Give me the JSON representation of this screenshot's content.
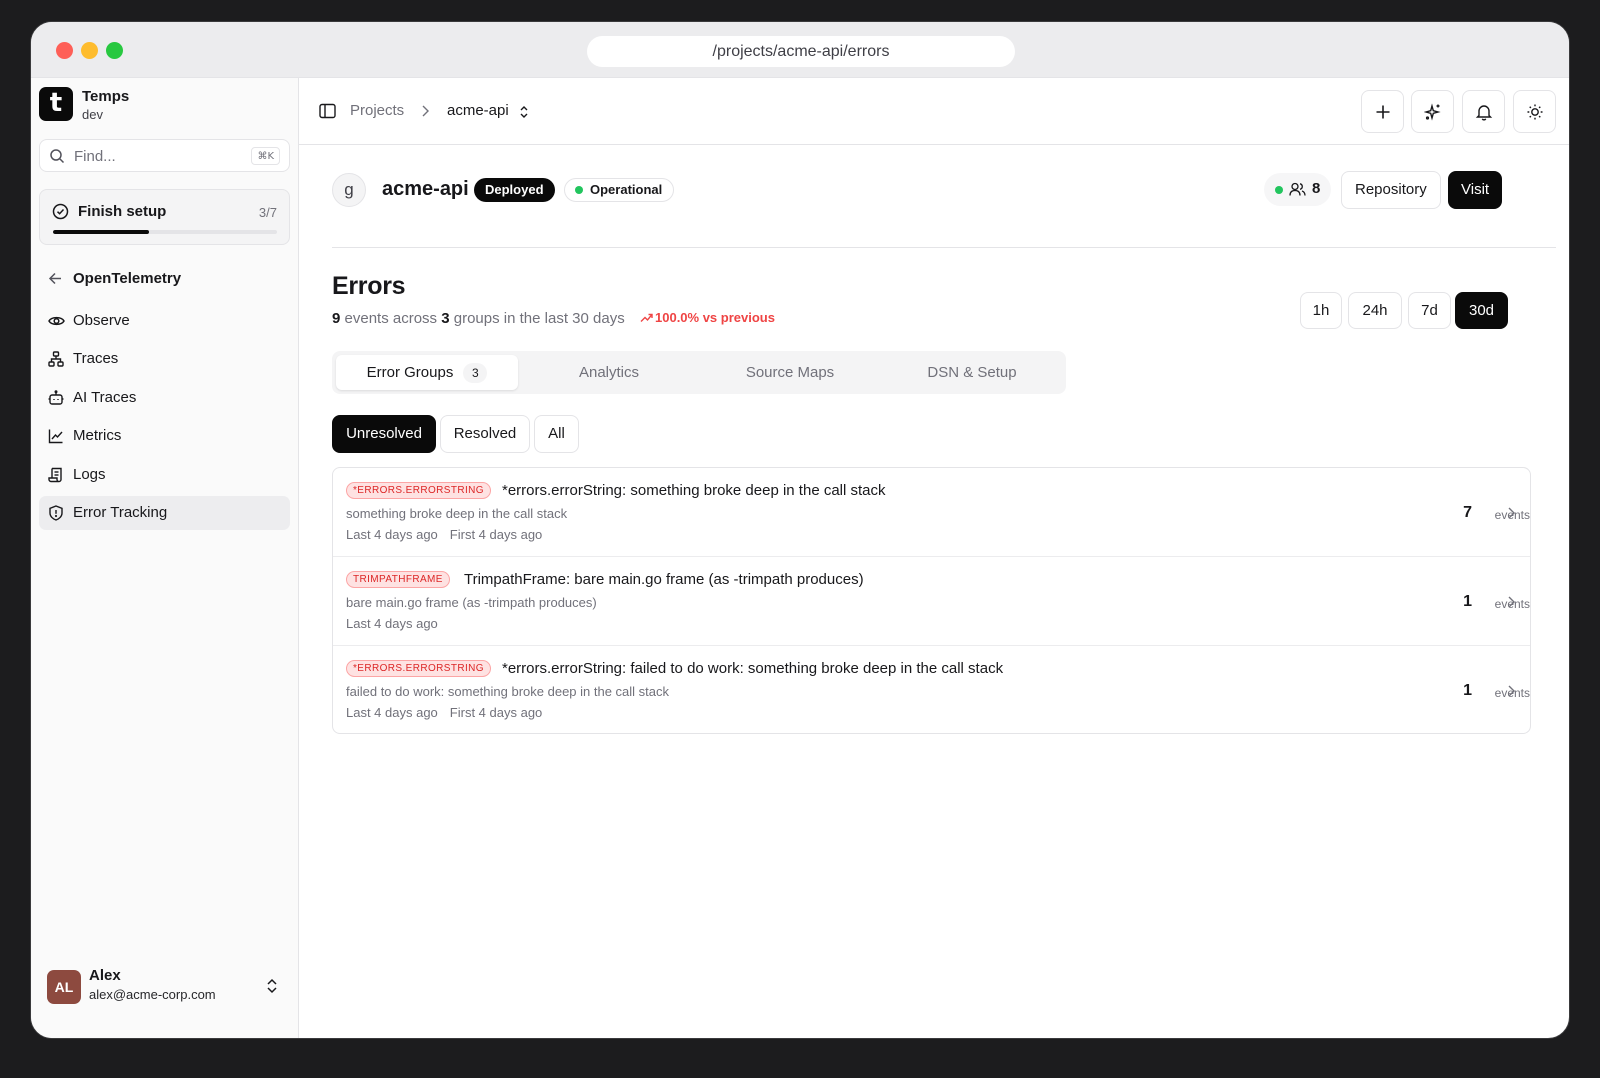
{
  "browser": {
    "url": "/projects/acme-api/errors"
  },
  "sidebar": {
    "brand": {
      "logo_letter": "t",
      "name": "Temps",
      "env": "dev"
    },
    "search": {
      "placeholder": "Find...",
      "shortcut": "⌘K"
    },
    "setup": {
      "label": "Finish setup",
      "count": "3/7",
      "progress": 0.43
    },
    "back": {
      "label": "OpenTelemetry"
    },
    "items": [
      {
        "label": "Observe",
        "icon": "eye-icon"
      },
      {
        "label": "Traces",
        "icon": "traces-icon"
      },
      {
        "label": "AI Traces",
        "icon": "bot-icon"
      },
      {
        "label": "Metrics",
        "icon": "chart-line-icon"
      },
      {
        "label": "Logs",
        "icon": "scroll-icon"
      },
      {
        "label": "Error Tracking",
        "icon": "shield-alert-icon",
        "active": true
      }
    ],
    "user": {
      "initials": "AL",
      "name": "Alex",
      "email": "alex@acme-corp.com"
    }
  },
  "topbar": {
    "breadcrumb": {
      "root": "Projects",
      "current": "acme-api"
    }
  },
  "project": {
    "avatar": "g",
    "name": "acme-api",
    "deploy_status": "Deployed",
    "health": "Operational",
    "viewers": "8",
    "repository_label": "Repository",
    "visit_label": "Visit"
  },
  "errors": {
    "title": "Errors",
    "summary": {
      "events": "9",
      "events_word": "events across",
      "groups": "3",
      "groups_word": "groups in the last 30 days"
    },
    "trend": "100.0% vs previous",
    "ranges": [
      "1h",
      "24h",
      "7d",
      "30d"
    ],
    "active_range": "30d",
    "tabs": {
      "groups": "Error Groups",
      "groups_count": "3",
      "analytics": "Analytics",
      "source_maps": "Source Maps",
      "dsn": "DSN & Setup"
    },
    "filters": {
      "unresolved": "Unresolved",
      "resolved": "Resolved",
      "all": "All"
    },
    "rows": [
      {
        "tag": "*ERRORS.ERRORSTRING",
        "title": "*errors.errorString: something broke deep in the call stack",
        "message": "something broke deep in the call stack",
        "last": "Last 4 days ago",
        "first": "First 4 days ago",
        "count": "7",
        "events_label": "events"
      },
      {
        "tag": "TRIMPATHFRAME",
        "title": "TrimpathFrame: bare main.go frame (as -trimpath produces)",
        "message": "bare main.go frame (as -trimpath produces)",
        "last": "Last 4 days ago",
        "first": "",
        "count": "1",
        "events_label": "events"
      },
      {
        "tag": "*ERRORS.ERRORSTRING",
        "title": "*errors.errorString: failed to do work: something broke deep in the call stack",
        "message": "failed to do work: something broke deep in the call stack",
        "last": "Last 4 days ago",
        "first": "First 4 days ago",
        "count": "1",
        "events_label": "events"
      }
    ]
  }
}
